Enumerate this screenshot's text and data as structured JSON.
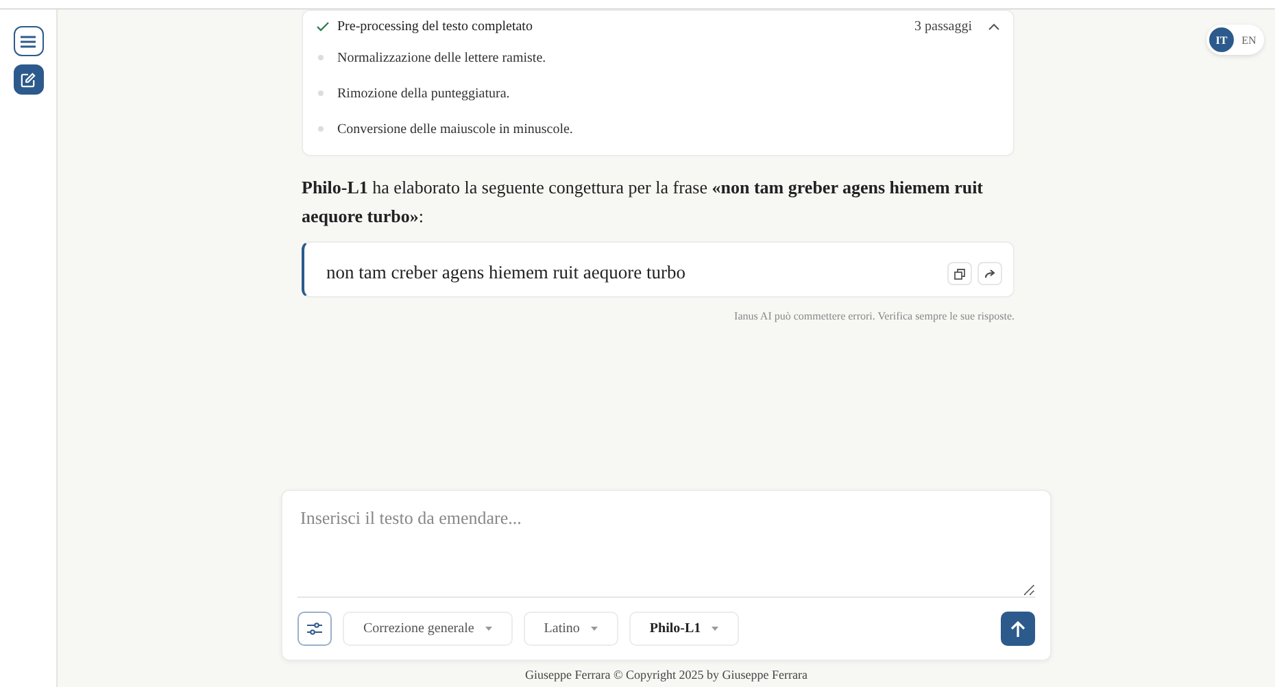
{
  "sidebar": {
    "buttons": [
      {
        "kind": "menu",
        "selected": false
      },
      {
        "kind": "new",
        "selected": true
      }
    ]
  },
  "language_toggle": [
    {
      "label": "IT",
      "selected": true
    },
    {
      "label": "EN",
      "selected": false
    }
  ],
  "preprocessing": {
    "title": "Pre-processing del testo completato",
    "count": "3 passaggi",
    "expanded": true,
    "steps": [
      "Normalizzazione delle lettere ramiste.",
      "Rimozione della punteggiatura.",
      "Conversione delle maiuscole in minuscole."
    ]
  },
  "message": "**Philo-L1** ha elaborato la seguente congettura per la frase **«non tam greber agens hiemem ruit aequore turbo»**:",
  "answer": "non tam creber agens hiemem ruit aequore turbo",
  "disclaimer": "Ianus AI può commettere errori. Verifica sempre le sue risposte.",
  "composer": {
    "placeholder": "Inserisci il testo da emendare...",
    "dropdowns": [
      {
        "label": "Correzione generale",
        "selected": false
      },
      {
        "label": "Latino",
        "selected": false
      },
      {
        "label": "Philo-L1",
        "selected": true
      }
    ]
  },
  "footer": "Giuseppe Ferrara © Copyright 2025 by Giuseppe Ferrara"
}
